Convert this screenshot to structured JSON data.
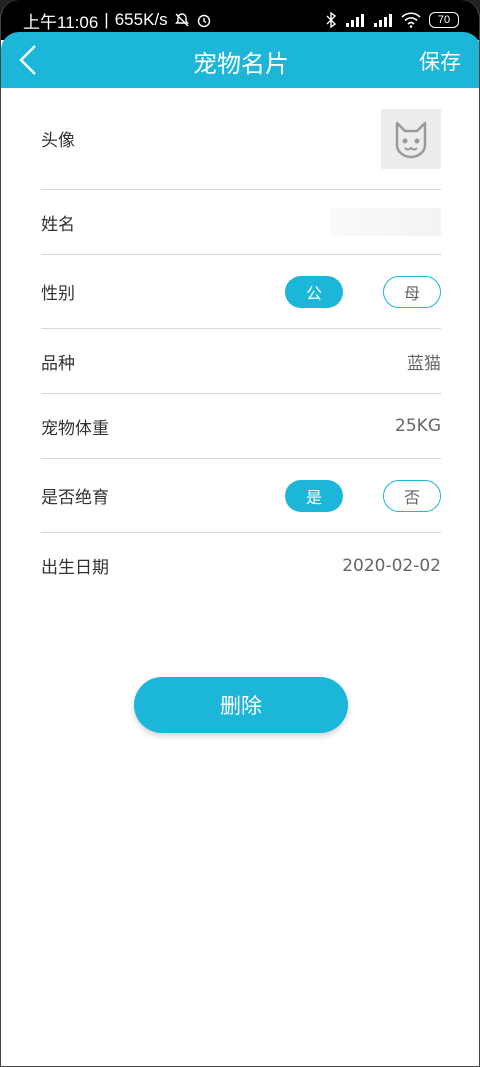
{
  "status_bar": {
    "time": "上午11:06",
    "net_speed": "655K/s",
    "battery": "70"
  },
  "header": {
    "title": "宠物名片",
    "save_label": "保存"
  },
  "rows": {
    "avatar": {
      "label": "头像"
    },
    "name": {
      "label": "姓名",
      "value": ""
    },
    "gender": {
      "label": "性别",
      "male": "公",
      "female": "母",
      "selected": "公"
    },
    "breed": {
      "label": "品种",
      "value": "蓝猫"
    },
    "weight": {
      "label": "宠物体重",
      "value": "25KG"
    },
    "neutered": {
      "label": "是否绝育",
      "yes": "是",
      "no": "否",
      "selected": "是"
    },
    "birthday": {
      "label": "出生日期",
      "value": "2020-02-02"
    }
  },
  "delete_label": "删除",
  "colors": {
    "accent": "#1cb6d9"
  }
}
